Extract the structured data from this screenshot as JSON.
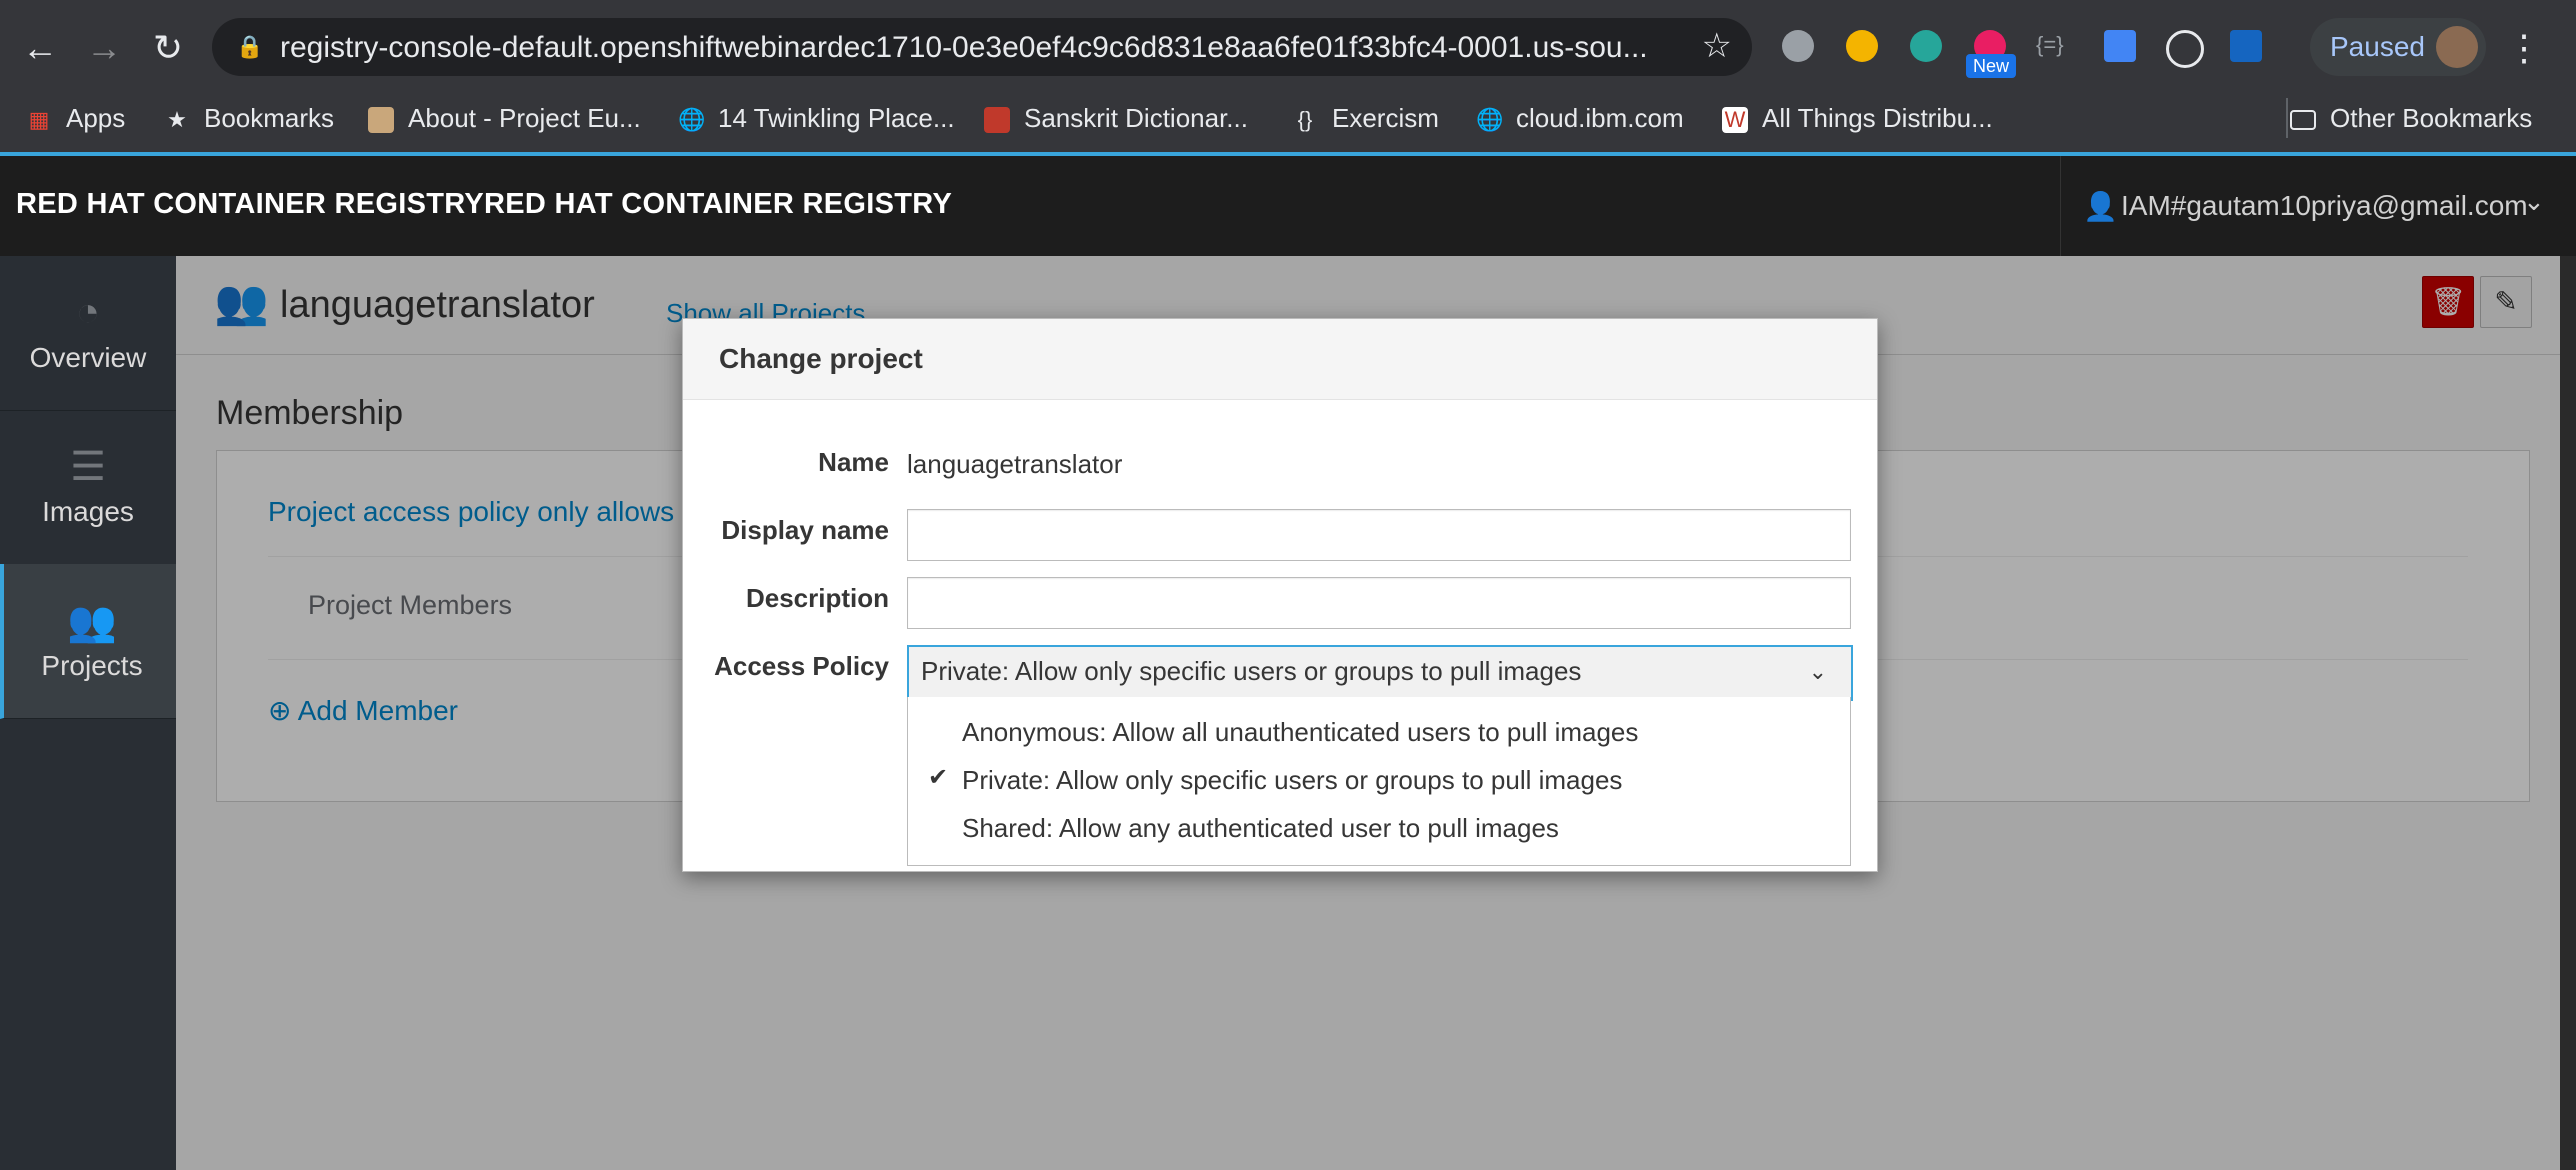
{
  "browser": {
    "url": "registry-console-default.openshiftwebinardec1710-0e3e0ef4c9c6d831e8aa6fe01f33bfc4-0001.us-sou...",
    "new_badge": "New",
    "profile_status": "Paused",
    "bookmarks": [
      {
        "label": "Apps",
        "icon": "apps-grid-icon"
      },
      {
        "label": "Bookmarks",
        "icon": "star-icon"
      },
      {
        "label": "About - Project Eu...",
        "icon": "project-euler-icon"
      },
      {
        "label": "14 Twinkling Place...",
        "icon": "globe-icon"
      },
      {
        "label": "Sanskrit Dictionar...",
        "icon": "sanskrit-dictionary-icon"
      },
      {
        "label": "Exercism",
        "icon": "exercism-icon"
      },
      {
        "label": "cloud.ibm.com",
        "icon": "globe-icon"
      },
      {
        "label": "All Things Distribu...",
        "icon": "all-things-distributed-icon"
      }
    ],
    "other_bookmarks": "Other Bookmarks"
  },
  "app": {
    "brand": "RED HAT CONTAINER REGISTRYRED HAT CONTAINER REGISTRY",
    "user": "IAM#gautam10priya@gmail.com"
  },
  "sidebar": {
    "items": [
      {
        "label": "Overview",
        "icon": "dashboard-icon",
        "active": false
      },
      {
        "label": "Images",
        "icon": "layers-icon",
        "active": false
      },
      {
        "label": "Projects",
        "icon": "users-icon",
        "active": true
      }
    ]
  },
  "project": {
    "name": "languagetranslator",
    "show_all": "Show all Projects"
  },
  "membership": {
    "title": "Membership",
    "policy_text": "Project access policy only allows sp",
    "members_header": "Project Members",
    "add_member": "Add Member"
  },
  "modal": {
    "title": "Change project",
    "labels": {
      "name": "Name",
      "display_name": "Display name",
      "description": "Description",
      "access_policy": "Access Policy"
    },
    "name_value": "languagetranslator",
    "display_name_value": "",
    "description_value": "",
    "access_policy_selected": "Private: Allow only specific users or groups to pull images",
    "options": [
      {
        "label": "Anonymous: Allow all unauthenticated users to pull images",
        "checked": false
      },
      {
        "label": "Private: Allow only specific users or groups to pull images",
        "checked": true
      },
      {
        "label": "Shared: Allow any authenticated user to pull images",
        "checked": false
      }
    ]
  },
  "colors": {
    "accent": "#39a5dc",
    "link": "#0088ce",
    "danger": "#cc0000",
    "sidebar": "#292e34",
    "header": "#1d1d1d"
  }
}
